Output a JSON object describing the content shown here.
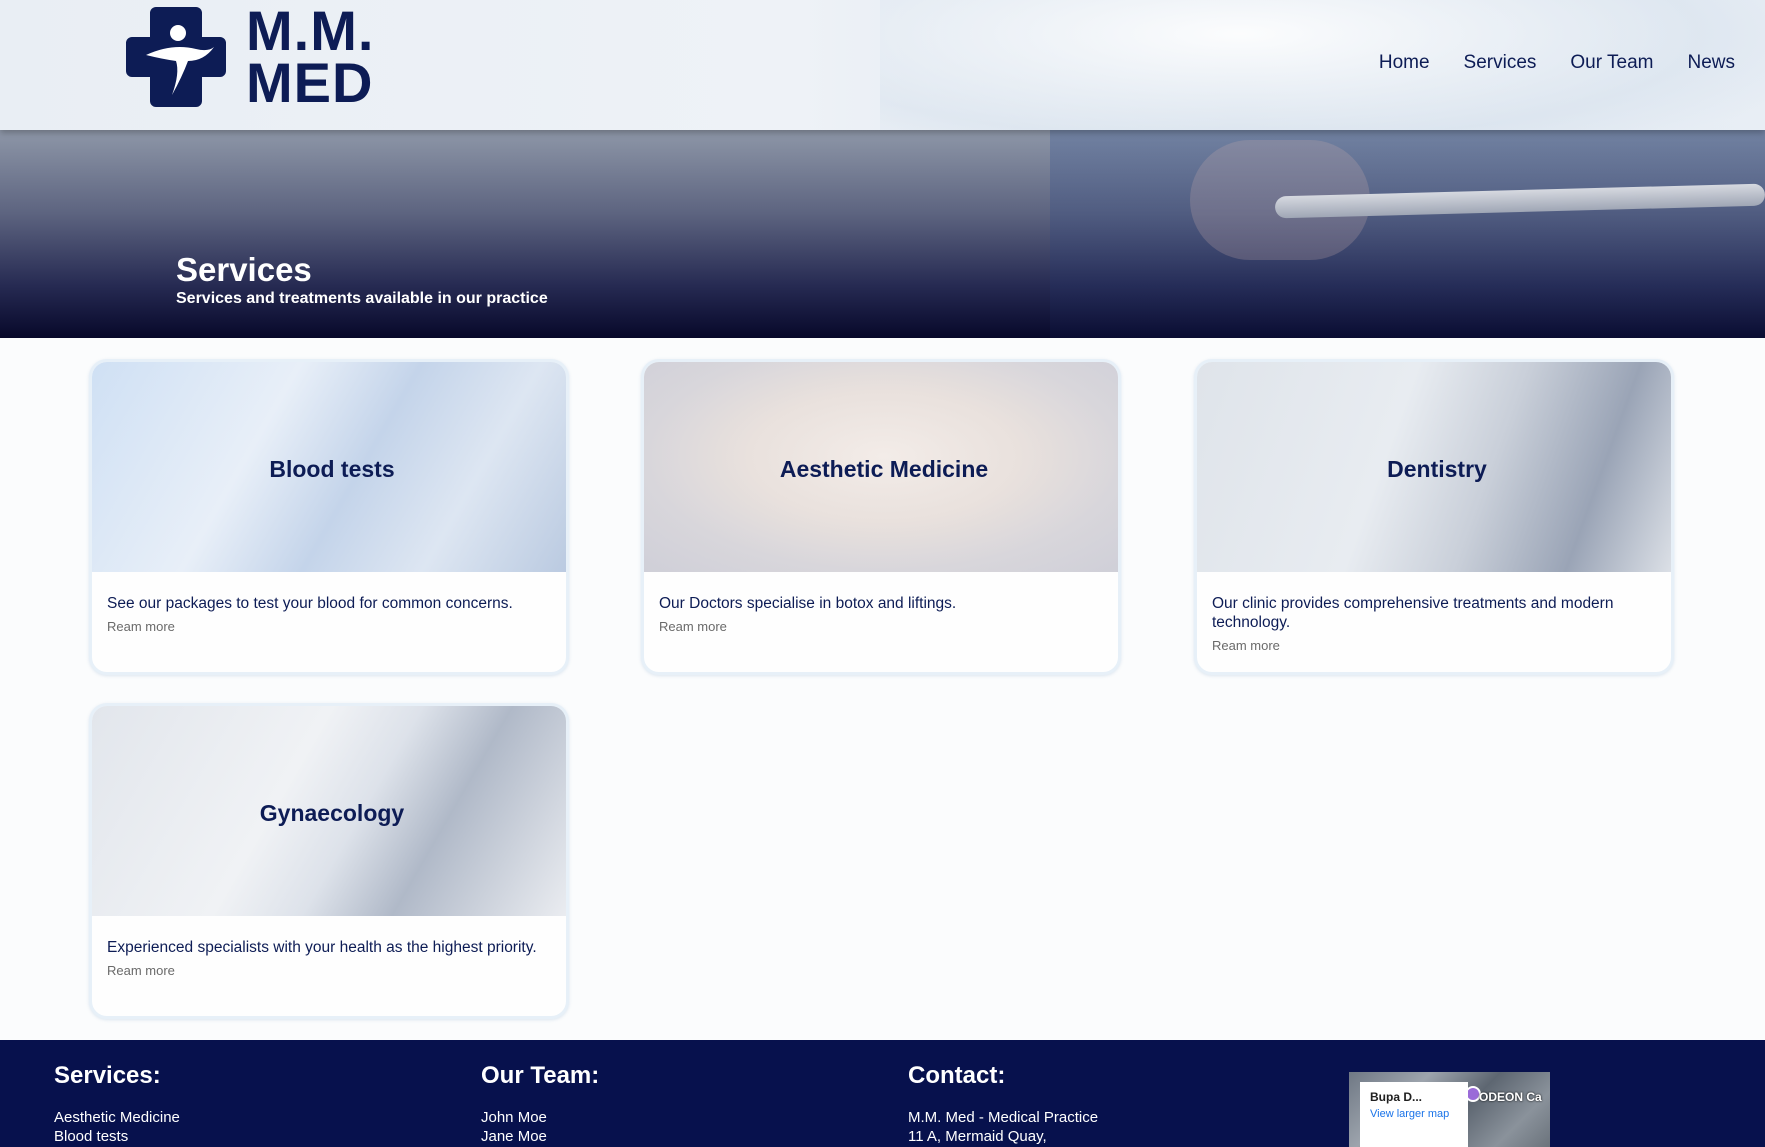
{
  "brand": {
    "line1": "M.M.",
    "line2": "MED",
    "color": "#0d1c55"
  },
  "nav": {
    "items": [
      "Home",
      "Services",
      "Our Team",
      "News"
    ]
  },
  "hero": {
    "title": "Services",
    "subtitle": "Services and treatments available in our practice"
  },
  "cards": [
    {
      "title": "Blood tests",
      "description": "See our packages to test your blood for common concerns.",
      "link": "Ream more"
    },
    {
      "title": "Aesthetic Medicine",
      "description": "Our Doctors specialise in botox and liftings.",
      "link": "Ream more"
    },
    {
      "title": "Dentistry",
      "description": "Our clinic provides comprehensive treatments and modern technology.",
      "link": "Ream more"
    },
    {
      "title": "Gynaecology",
      "description": "Experienced specialists with your health as the highest priority.",
      "link": "Ream more"
    }
  ],
  "footer": {
    "services": {
      "heading": "Services:",
      "items": [
        "Aesthetic Medicine",
        "Blood tests"
      ]
    },
    "team": {
      "heading": "Our Team:",
      "items": [
        "John Moe",
        "Jane Moe"
      ]
    },
    "contact": {
      "heading": "Contact:",
      "lines": [
        "M.M. Med - Medical Practice",
        "11 A, Mermaid Quay,"
      ]
    },
    "map": {
      "place": "Bupa D...",
      "link": "View larger map",
      "label": "ODEON Ca"
    }
  },
  "colors": {
    "primary": "#0d1c55",
    "footer_bg": "#07114d",
    "card_border": "#e7f0f8"
  }
}
